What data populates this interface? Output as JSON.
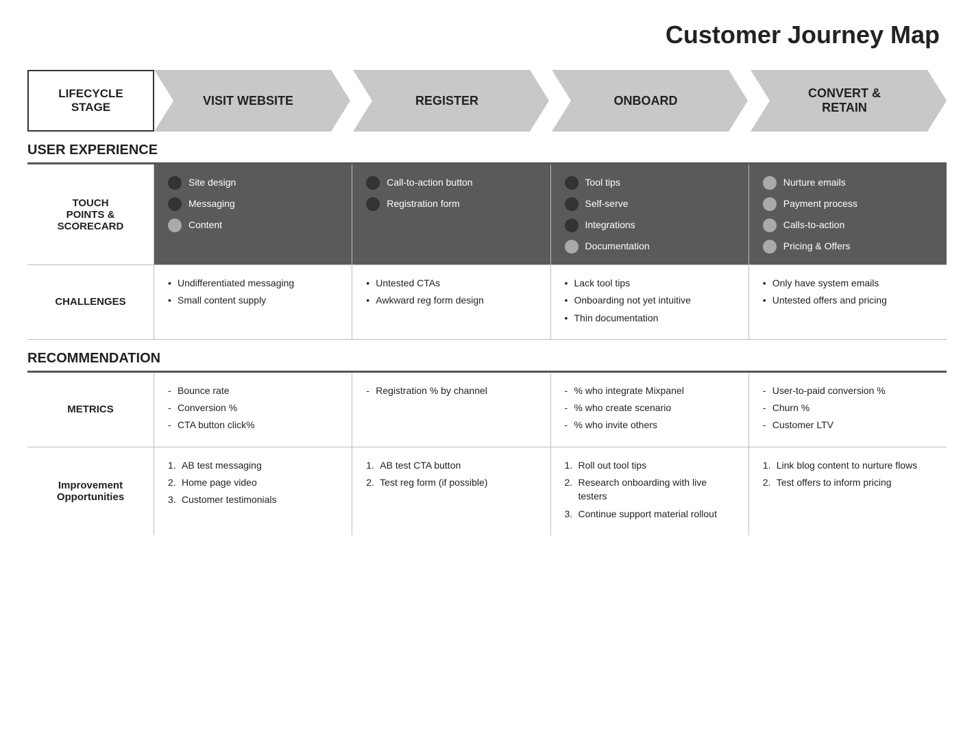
{
  "title": "Customer Journey Map",
  "lifecycle": {
    "label": "LIFECYCLE\nSTAGE",
    "stages": [
      {
        "name": "VISIT WEBSITE"
      },
      {
        "name": "REGISTER"
      },
      {
        "name": "ONBOARD"
      },
      {
        "name": "CONVERT &\nRETAIN"
      }
    ]
  },
  "user_experience_label": "USER EXPERIENCE",
  "touch_points": {
    "row_label": "TOUCH\nPOINTS &\nSCORECARD",
    "cells": [
      {
        "items": [
          {
            "label": "Site design",
            "dot": "dark"
          },
          {
            "label": "Messaging",
            "dot": "dark"
          },
          {
            "label": "Content",
            "dot": "light"
          }
        ]
      },
      {
        "items": [
          {
            "label": "Call-to-action button",
            "dot": "dark"
          },
          {
            "label": "Registration form",
            "dot": "dark"
          }
        ]
      },
      {
        "items": [
          {
            "label": "Tool tips",
            "dot": "dark"
          },
          {
            "label": "Self-serve",
            "dot": "dark"
          },
          {
            "label": "Integrations",
            "dot": "dark"
          },
          {
            "label": "Documentation",
            "dot": "light"
          }
        ]
      },
      {
        "items": [
          {
            "label": "Nurture emails",
            "dot": "light"
          },
          {
            "label": "Payment process",
            "dot": "light"
          },
          {
            "label": "Calls-to-action",
            "dot": "light"
          },
          {
            "label": "Pricing & Offers",
            "dot": "light"
          }
        ]
      }
    ]
  },
  "challenges": {
    "row_label": "CHALLENGES",
    "cells": [
      {
        "items": [
          "Undifferentiated messaging",
          "Small content supply"
        ]
      },
      {
        "items": [
          "Untested CTAs",
          "Awkward reg form design"
        ]
      },
      {
        "items": [
          "Lack tool tips",
          "Onboarding not yet intuitive",
          "Thin documentation"
        ]
      },
      {
        "items": [
          "Only have system emails",
          "Untested offers and pricing"
        ]
      }
    ]
  },
  "recommendation_label": "RECOMMENDATION",
  "metrics": {
    "row_label": "METRICS",
    "cells": [
      {
        "items": [
          "Bounce rate",
          "Conversion %",
          "CTA button click%"
        ]
      },
      {
        "items": [
          "Registration % by channel"
        ]
      },
      {
        "items": [
          "% who integrate Mixpanel",
          "% who create scenario",
          "% who invite others"
        ]
      },
      {
        "items": [
          "User-to-paid conversion %",
          "Churn %",
          "Customer LTV"
        ]
      }
    ]
  },
  "improvements": {
    "row_label": "Improvement\nOpportunities",
    "cells": [
      {
        "items": [
          "AB test messaging",
          "Home page video",
          "Customer testimonials"
        ]
      },
      {
        "items": [
          "AB test CTA button",
          "Test reg form (if possible)"
        ]
      },
      {
        "items": [
          "Roll out tool tips",
          "Research onboarding with live testers",
          "Continue support material rollout"
        ]
      },
      {
        "items": [
          "Link blog content to nurture flows",
          "Test offers to inform pricing"
        ]
      }
    ]
  }
}
